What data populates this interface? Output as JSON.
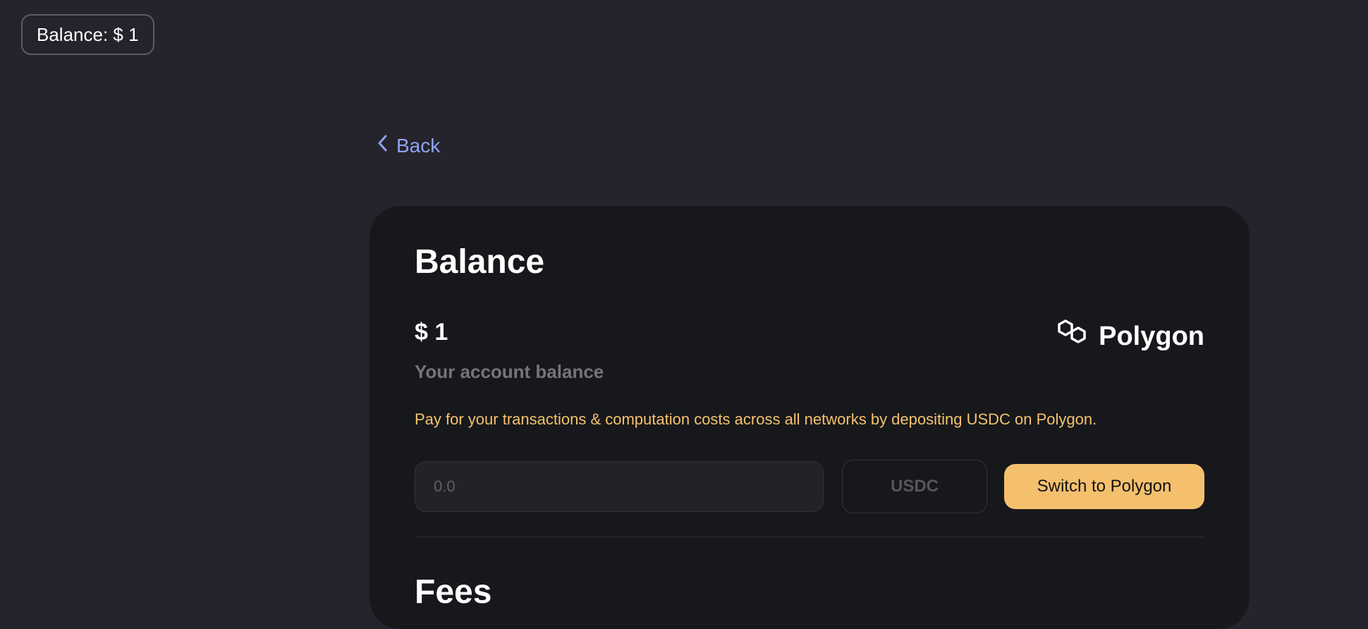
{
  "header": {
    "balance_label": "Balance: $ 1"
  },
  "nav": {
    "back_label": "Back"
  },
  "balance_card": {
    "title": "Balance",
    "amount": "$ 1",
    "amount_caption": "Your account balance",
    "network_name": "Polygon",
    "network_icon": "polygon-logo-icon",
    "info_text": "Pay for your transactions & computation costs across all networks by depositing USDC on Polygon.",
    "amount_input": {
      "value": "",
      "placeholder": "0.0"
    },
    "token": "USDC",
    "switch_button_label": "Switch to Polygon"
  },
  "fees_section": {
    "title": "Fees"
  },
  "colors": {
    "page_background": "#25232b",
    "card_background": "#17181c",
    "accent_link": "#8ea2f2",
    "info_text": "#f5c26b",
    "primary_button": "#f5c06e"
  }
}
